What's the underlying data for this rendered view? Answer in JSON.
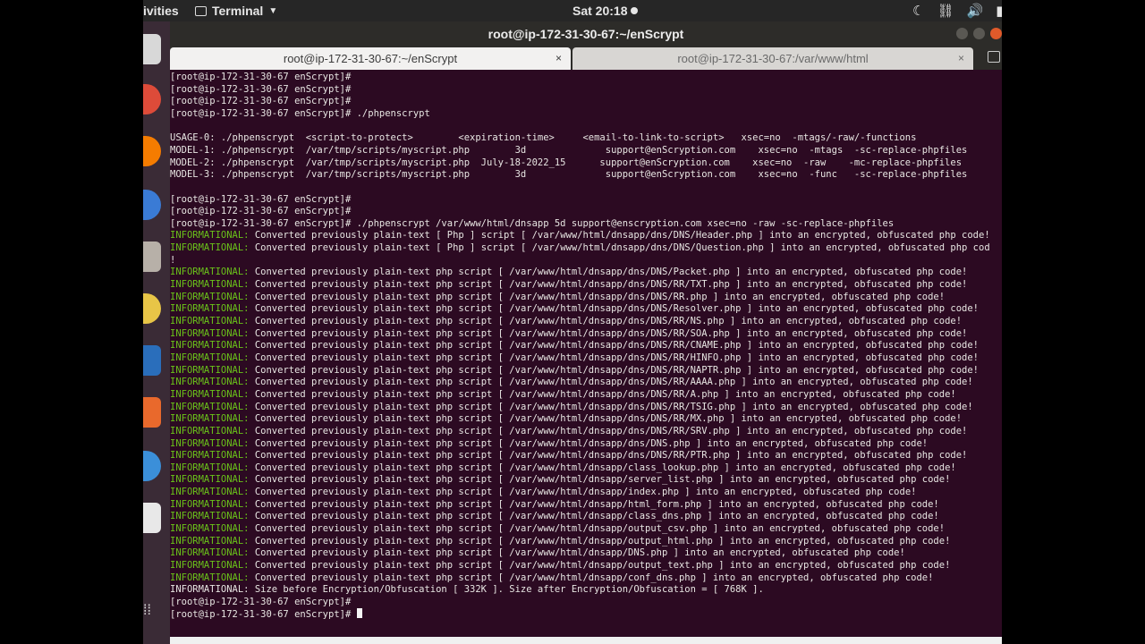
{
  "topbar": {
    "activities": "ivities",
    "app_name": "Terminal",
    "clock": "Sat 20:18"
  },
  "window": {
    "title": "root@ip-172-31-30-67:~/enScrypt"
  },
  "tabs": [
    {
      "label": "root@ip-172-31-30-67:~/enScrypt",
      "close": "×"
    },
    {
      "label": "root@ip-172-31-30-67:/var/www/html",
      "close": "×"
    }
  ],
  "icons": {
    "tray": [
      "moon-icon",
      "network-icon",
      "volume-icon",
      "battery-icon"
    ],
    "dock": [
      "app-icon",
      "chrome-icon",
      "firefox-icon",
      "thunderbird-icon",
      "files-icon",
      "rhythmbox-icon",
      "writer-icon",
      "software-icon",
      "help-icon",
      "amazon-icon",
      "show-apps-icon"
    ]
  },
  "colors": {
    "terminal_bg": "#2c0a22",
    "info_green": "#6ac21a",
    "text": "#e8e6e3"
  },
  "terminal": {
    "lines": [
      {
        "text": "[root@ip-172-31-30-67 enScrypt]#"
      },
      {
        "text": "[root@ip-172-31-30-67 enScrypt]#"
      },
      {
        "text": "[root@ip-172-31-30-67 enScrypt]#"
      },
      {
        "text": "[root@ip-172-31-30-67 enScrypt]# ./phpenscrypt"
      },
      {
        "text": ""
      },
      {
        "text": "USAGE-0: ./phpenscrypt  <script-to-protect>        <expiration-time>     <email-to-link-to-script>   xsec=no  -mtags/-raw/-functions"
      },
      {
        "text": "MODEL-1: ./phpenscrypt  /var/tmp/scripts/myscript.php        3d              support@enScryption.com    xsec=no  -mtags  -sc-replace-phpfiles"
      },
      {
        "text": "MODEL-2: ./phpenscrypt  /var/tmp/scripts/myscript.php  July-18-2022_15      support@enScryption.com    xsec=no  -raw    -mc-replace-phpfiles"
      },
      {
        "text": "MODEL-3: ./phpenscrypt  /var/tmp/scripts/myscript.php        3d              support@enScryption.com    xsec=no  -func   -sc-replace-phpfiles"
      },
      {
        "text": ""
      },
      {
        "text": "[root@ip-172-31-30-67 enScrypt]#"
      },
      {
        "text": "[root@ip-172-31-30-67 enScrypt]#"
      },
      {
        "text": "[root@ip-172-31-30-67 enScrypt]# ./phpenscrypt /var/www/html/dnsapp 5d support@enscryption.com xsec=no -raw -sc-replace-phpfiles"
      },
      {
        "tag": "INFORMATIONAL:",
        "text": " Converted previously plain-text [ Php ] script [ /var/www/html/dnsapp/dns/DNS/Header.php ] into an encrypted, obfuscated php code!"
      },
      {
        "tag": "INFORMATIONAL:",
        "text": " Converted previously plain-text [ Php ] script [ /var/www/html/dnsapp/dns/DNS/Question.php ] into an encrypted, obfuscated php cod"
      },
      {
        "text": "!"
      },
      {
        "tag": "INFORMATIONAL:",
        "text": " Converted previously plain-text php script [ /var/www/html/dnsapp/dns/DNS/Packet.php ] into an encrypted, obfuscated php code!"
      },
      {
        "tag": "INFORMATIONAL:",
        "text": " Converted previously plain-text php script [ /var/www/html/dnsapp/dns/DNS/RR/TXT.php ] into an encrypted, obfuscated php code!"
      },
      {
        "tag": "INFORMATIONAL:",
        "text": " Converted previously plain-text php script [ /var/www/html/dnsapp/dns/DNS/RR.php ] into an encrypted, obfuscated php code!"
      },
      {
        "tag": "INFORMATIONAL:",
        "text": " Converted previously plain-text php script [ /var/www/html/dnsapp/dns/DNS/Resolver.php ] into an encrypted, obfuscated php code!"
      },
      {
        "tag": "INFORMATIONAL:",
        "text": " Converted previously plain-text php script [ /var/www/html/dnsapp/dns/DNS/RR/NS.php ] into an encrypted, obfuscated php code!"
      },
      {
        "tag": "INFORMATIONAL:",
        "text": " Converted previously plain-text php script [ /var/www/html/dnsapp/dns/DNS/RR/SOA.php ] into an encrypted, obfuscated php code!"
      },
      {
        "tag": "INFORMATIONAL:",
        "text": " Converted previously plain-text php script [ /var/www/html/dnsapp/dns/DNS/RR/CNAME.php ] into an encrypted, obfuscated php code!"
      },
      {
        "tag": "INFORMATIONAL:",
        "text": " Converted previously plain-text php script [ /var/www/html/dnsapp/dns/DNS/RR/HINFO.php ] into an encrypted, obfuscated php code!"
      },
      {
        "tag": "INFORMATIONAL:",
        "text": " Converted previously plain-text php script [ /var/www/html/dnsapp/dns/DNS/RR/NAPTR.php ] into an encrypted, obfuscated php code!"
      },
      {
        "tag": "INFORMATIONAL:",
        "text": " Converted previously plain-text php script [ /var/www/html/dnsapp/dns/DNS/RR/AAAA.php ] into an encrypted, obfuscated php code!"
      },
      {
        "tag": "INFORMATIONAL:",
        "text": " Converted previously plain-text php script [ /var/www/html/dnsapp/dns/DNS/RR/A.php ] into an encrypted, obfuscated php code!"
      },
      {
        "tag": "INFORMATIONAL:",
        "text": " Converted previously plain-text php script [ /var/www/html/dnsapp/dns/DNS/RR/TSIG.php ] into an encrypted, obfuscated php code!"
      },
      {
        "tag": "INFORMATIONAL:",
        "text": " Converted previously plain-text php script [ /var/www/html/dnsapp/dns/DNS/RR/MX.php ] into an encrypted, obfuscated php code!"
      },
      {
        "tag": "INFORMATIONAL:",
        "text": " Converted previously plain-text php script [ /var/www/html/dnsapp/dns/DNS/RR/SRV.php ] into an encrypted, obfuscated php code!"
      },
      {
        "tag": "INFORMATIONAL:",
        "text": " Converted previously plain-text php script [ /var/www/html/dnsapp/dns/DNS.php ] into an encrypted, obfuscated php code!"
      },
      {
        "tag": "INFORMATIONAL:",
        "text": " Converted previously plain-text php script [ /var/www/html/dnsapp/dns/DNS/RR/PTR.php ] into an encrypted, obfuscated php code!"
      },
      {
        "tag": "INFORMATIONAL:",
        "text": " Converted previously plain-text php script [ /var/www/html/dnsapp/class_lookup.php ] into an encrypted, obfuscated php code!"
      },
      {
        "tag": "INFORMATIONAL:",
        "text": " Converted previously plain-text php script [ /var/www/html/dnsapp/server_list.php ] into an encrypted, obfuscated php code!"
      },
      {
        "tag": "INFORMATIONAL:",
        "text": " Converted previously plain-text php script [ /var/www/html/dnsapp/index.php ] into an encrypted, obfuscated php code!"
      },
      {
        "tag": "INFORMATIONAL:",
        "text": " Converted previously plain-text php script [ /var/www/html/dnsapp/html_form.php ] into an encrypted, obfuscated php code!"
      },
      {
        "tag": "INFORMATIONAL:",
        "text": " Converted previously plain-text php script [ /var/www/html/dnsapp/class_dns.php ] into an encrypted, obfuscated php code!"
      },
      {
        "tag": "INFORMATIONAL:",
        "text": " Converted previously plain-text php script [ /var/www/html/dnsapp/output_csv.php ] into an encrypted, obfuscated php code!"
      },
      {
        "tag": "INFORMATIONAL:",
        "text": " Converted previously plain-text php script [ /var/www/html/dnsapp/output_html.php ] into an encrypted, obfuscated php code!"
      },
      {
        "tag": "INFORMATIONAL:",
        "text": " Converted previously plain-text php script [ /var/www/html/dnsapp/DNS.php ] into an encrypted, obfuscated php code!"
      },
      {
        "tag": "INFORMATIONAL:",
        "text": " Converted previously plain-text php script [ /var/www/html/dnsapp/output_text.php ] into an encrypted, obfuscated php code!"
      },
      {
        "tag": "INFORMATIONAL:",
        "text": " Converted previously plain-text php script [ /var/www/html/dnsapp/conf_dns.php ] into an encrypted, obfuscated php code!"
      },
      {
        "text": "INFORMATIONAL: Size before Encryption/Obfuscation [ 332K ]. Size after Encryption/Obfuscation = [ 768K ]."
      },
      {
        "text": "[root@ip-172-31-30-67 enScrypt]#"
      },
      {
        "text": "[root@ip-172-31-30-67 enScrypt]# ",
        "cursor": true
      }
    ]
  }
}
